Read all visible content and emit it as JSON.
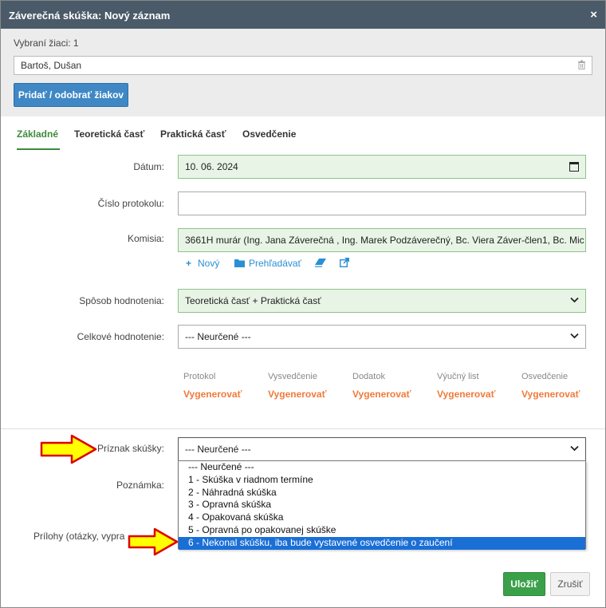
{
  "dialog": {
    "title": "Záverečná skúška: Nový záznam",
    "close_icon": "×"
  },
  "students": {
    "label": "Vybraní žiaci: 1",
    "selected": "Bartoš, Dušan",
    "add_remove_button": "Pridať / odobrať žiakov"
  },
  "tabs": [
    {
      "label": "Základné",
      "active": true
    },
    {
      "label": "Teoretická časť"
    },
    {
      "label": "Praktická časť"
    },
    {
      "label": "Osvedčenie"
    }
  ],
  "form": {
    "date_label": "Dátum:",
    "date_value": "10. 06. 2024",
    "protocol_label": "Číslo protokolu:",
    "protocol_value": "",
    "commission_label": "Komisia:",
    "commission_value": "3661H murár (Ing. Jana Záverečná , Ing. Marek Podzáverečný, Bc. Viera Záver-člen1, Bc. Mic",
    "commission_links": {
      "new": "Nový",
      "browse": "Prehľadávať"
    },
    "evaluation_method_label": "Spôsob hodnotenia:",
    "evaluation_method_value": "Teoretická časť + Praktická časť",
    "overall_label": "Celkové hodnotenie:",
    "overall_value": "--- Neurčené ---",
    "exam_flag_label": "Príznak skúšky:",
    "exam_flag_value": "--- Neurčené ---",
    "note_label": "Poznámka:",
    "attachments_label": "Prílohy (otázky, vypra"
  },
  "generate": [
    {
      "header": "Protokol",
      "action": "Vygenerovať"
    },
    {
      "header": "Vysvedčenie",
      "action": "Vygenerovať"
    },
    {
      "header": "Dodatok",
      "action": "Vygenerovať"
    },
    {
      "header": "Výučný list",
      "action": "Vygenerovať"
    },
    {
      "header": "Osvedčenie",
      "action": "Vygenerovať"
    }
  ],
  "dropdown_options": [
    "--- Neurčené ---",
    "1 - Skúška v riadnom termíne",
    "2 - Náhradná skúška",
    "3 - Opravná skúška",
    "4 - Opakovaná skúška",
    "5 - Opravná po opakovanej skúške",
    "6 - Nekonal skúšku, iba bude vystavené osvedčenie o zaučení"
  ],
  "dropdown_selected_index": 6,
  "footer": {
    "save": "Uložiť",
    "cancel": "Zrušiť"
  },
  "colors": {
    "titlebar": "#4a5a68",
    "accent_green": "#3c8a3c",
    "link_blue": "#2a8fd4",
    "generate_orange": "#f07a3a",
    "highlight_blue": "#1a6fd6",
    "arrow_yellow": "#ffff00",
    "arrow_red": "#e00000"
  }
}
